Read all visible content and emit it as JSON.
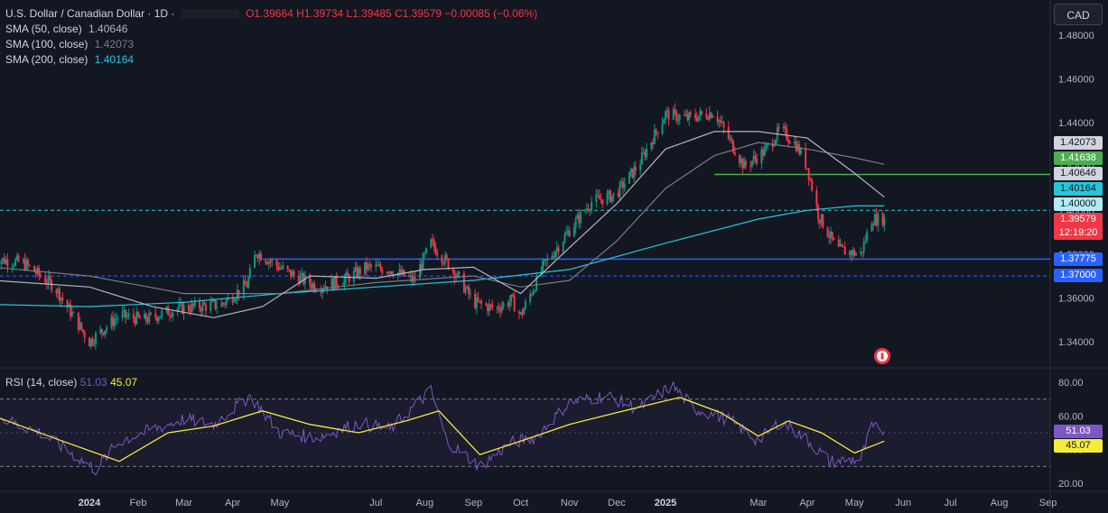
{
  "legend": {
    "title": "U.S. Dollar / Canadian Dollar · 1D ·",
    "open": "O1.39664",
    "high": "H1.39734",
    "low": "L1.39485",
    "close": "C1.39579",
    "change": "−0.00085 (−0.06%)",
    "sma50_label": "SMA (50, close)",
    "sma50_value": "1.40646",
    "sma100_label": "SMA (100, close)",
    "sma100_value": "1.42073",
    "sma200_label": "SMA (200, close)",
    "sma200_value": "1.40164",
    "rsi_label": "RSI (14, close)",
    "rsi_value": "51.03",
    "rsi_ma_value": "45.07"
  },
  "currency_button": "CAD",
  "price_tags": {
    "sma100": "1.42073",
    "level_green": "1.41638",
    "sma50": "1.40646",
    "sma200": "1.40164",
    "level_dashed_upper": "1.40000",
    "last_price": "1.39579",
    "countdown": "12:19:20",
    "level_blue": "1.37775",
    "level_dashed_lower": "1.37000",
    "rsi_value": "51.03",
    "rsi_ma": "45.07"
  },
  "colors": {
    "background": "#131722",
    "up_candle": "#089981",
    "down_candle": "#f23645",
    "sma50": "#b2b5be",
    "sma100": "#787b86",
    "sma200": "#26c6da",
    "green_line": "#4caf50",
    "blue_line": "#2962ff",
    "rsi_line": "#7e57c2",
    "rsi_ma": "#f5eb3b"
  },
  "chart_data": [
    {
      "type": "candlestick",
      "title": "U.S. Dollar / Canadian Dollar · 1D",
      "y_axis_ticks": [
        1.34,
        1.36,
        1.38,
        1.4,
        1.42,
        1.44,
        1.46,
        1.48
      ],
      "y_axis_tick_labels": [
        "1.34000",
        "1.36000",
        "1.38000",
        "1.40000",
        "1.42000",
        "1.44000",
        "1.46000",
        "1.48000"
      ],
      "x_axis_labels": [
        "2024",
        "Feb",
        "Mar",
        "Apr",
        "May",
        "Jul",
        "Aug",
        "Sep",
        "Oct",
        "Nov",
        "Dec",
        "2025",
        "Mar",
        "Apr",
        "May",
        "Jun",
        "Jul",
        "Aug",
        "Sep"
      ],
      "x_axis_dates": [
        "2024-01-01",
        "2024-02-01",
        "2024-03-01",
        "2024-04-01",
        "2024-05-01",
        "2024-07-01",
        "2024-08-01",
        "2024-09-01",
        "2024-10-01",
        "2024-11-01",
        "2024-12-01",
        "2025-01-01",
        "2025-03-01",
        "2025-04-01",
        "2025-05-01",
        "2025-06-01",
        "2025-07-01",
        "2025-08-01",
        "2025-09-01"
      ],
      "last_close": 1.39579,
      "horizontal_levels": [
        {
          "value": 1.41638,
          "style": "solid",
          "color": "#4caf50",
          "from_date": "2025-02-01"
        },
        {
          "value": 1.4,
          "style": "dashed",
          "color": "#26c6da"
        },
        {
          "value": 1.37775,
          "style": "solid",
          "color": "#2962ff",
          "from_date": "2024-04-20"
        },
        {
          "value": 1.37,
          "style": "dashed",
          "color": "#2962ff"
        }
      ],
      "series_price": {
        "name": "U.S. Dollar / Canadian Dollar",
        "dates": [
          "2023-11-01",
          "2023-11-20",
          "2023-12-10",
          "2024-01-01",
          "2024-01-20",
          "2024-02-05",
          "2024-02-25",
          "2024-03-10",
          "2024-03-25",
          "2024-04-10",
          "2024-04-16",
          "2024-05-05",
          "2024-05-25",
          "2024-06-10",
          "2024-06-25",
          "2024-07-10",
          "2024-07-25",
          "2024-08-05",
          "2024-08-20",
          "2024-09-01",
          "2024-09-15",
          "2024-09-25",
          "2024-10-01",
          "2024-10-15",
          "2024-10-31",
          "2024-11-15",
          "2024-11-30",
          "2024-12-15",
          "2025-01-01",
          "2025-01-15",
          "2025-02-01",
          "2025-02-10",
          "2025-02-20",
          "2025-03-05",
          "2025-03-15",
          "2025-03-25",
          "2025-04-01",
          "2025-04-08",
          "2025-04-20",
          "2025-05-05",
          "2025-05-12",
          "2025-05-20"
        ],
        "values": [
          1.378,
          1.376,
          1.365,
          1.34,
          1.352,
          1.35,
          1.355,
          1.356,
          1.357,
          1.366,
          1.381,
          1.372,
          1.365,
          1.368,
          1.374,
          1.373,
          1.368,
          1.385,
          1.372,
          1.358,
          1.355,
          1.359,
          1.352,
          1.374,
          1.39,
          1.404,
          1.407,
          1.421,
          1.444,
          1.442,
          1.445,
          1.433,
          1.42,
          1.427,
          1.437,
          1.43,
          1.42,
          1.398,
          1.382,
          1.38,
          1.396,
          1.396
        ]
      },
      "series_sma50": {
        "name": "SMA (50, close)",
        "dates": [
          "2023-11-01",
          "2024-01-01",
          "2024-02-10",
          "2024-03-20",
          "2024-04-20",
          "2024-05-20",
          "2024-07-01",
          "2024-08-01",
          "2024-09-01",
          "2024-10-01",
          "2024-11-01",
          "2024-12-01",
          "2025-01-01",
          "2025-02-01",
          "2025-03-01",
          "2025-04-01",
          "2025-05-01",
          "2025-05-20"
        ],
        "values": [
          1.368,
          1.365,
          1.356,
          1.351,
          1.356,
          1.37,
          1.369,
          1.373,
          1.374,
          1.362,
          1.383,
          1.403,
          1.428,
          1.436,
          1.436,
          1.433,
          1.417,
          1.406
        ]
      },
      "series_sma100": {
        "name": "SMA (100, close)",
        "dates": [
          "2023-11-01",
          "2024-01-01",
          "2024-03-01",
          "2024-05-01",
          "2024-07-01",
          "2024-09-01",
          "2024-10-01",
          "2024-11-01",
          "2024-12-01",
          "2025-01-01",
          "2025-02-01",
          "2025-03-01",
          "2025-04-01",
          "2025-05-01",
          "2025-05-20"
        ],
        "values": [
          1.374,
          1.37,
          1.362,
          1.362,
          1.367,
          1.37,
          1.365,
          1.368,
          1.386,
          1.41,
          1.425,
          1.431,
          1.428,
          1.424,
          1.421
        ]
      },
      "series_sma200": {
        "name": "SMA (200, close)",
        "dates": [
          "2023-11-01",
          "2024-01-01",
          "2024-03-01",
          "2024-05-01",
          "2024-07-01",
          "2024-09-01",
          "2024-11-01",
          "2025-01-01",
          "2025-03-01",
          "2025-04-01",
          "2025-05-01",
          "2025-05-20"
        ],
        "values": [
          1.357,
          1.356,
          1.358,
          1.362,
          1.365,
          1.368,
          1.373,
          1.385,
          1.396,
          1.4,
          1.402,
          1.402
        ]
      }
    },
    {
      "type": "line",
      "title": "RSI (14, close)",
      "y_axis_ticks": [
        20,
        40,
        60,
        80
      ],
      "y_axis_tick_labels": [
        "20.00",
        "40.00",
        "60.00",
        "80.00"
      ],
      "bands": [
        30,
        70
      ],
      "series": [
        {
          "name": "RSI",
          "dates": [
            "2023-11-01",
            "2023-12-01",
            "2024-01-05",
            "2024-01-20",
            "2024-02-10",
            "2024-03-01",
            "2024-03-20",
            "2024-04-12",
            "2024-05-01",
            "2024-05-25",
            "2024-06-20",
            "2024-07-10",
            "2024-08-05",
            "2024-08-15",
            "2024-09-05",
            "2024-09-25",
            "2024-10-10",
            "2024-11-01",
            "2024-11-25",
            "2024-12-15",
            "2025-01-05",
            "2025-01-20",
            "2025-02-10",
            "2025-03-01",
            "2025-03-15",
            "2025-04-01",
            "2025-04-15",
            "2025-05-05",
            "2025-05-12",
            "2025-05-20"
          ],
          "values": [
            60,
            50,
            28,
            45,
            52,
            58,
            55,
            72,
            50,
            47,
            56,
            52,
            75,
            45,
            30,
            44,
            47,
            68,
            72,
            64,
            78,
            64,
            58,
            45,
            57,
            46,
            33,
            34,
            53,
            51
          ]
        },
        {
          "name": "RSI-based MA",
          "dates": [
            "2023-11-01",
            "2023-12-15",
            "2024-01-20",
            "2024-02-20",
            "2024-03-20",
            "2024-04-20",
            "2024-05-20",
            "2024-06-20",
            "2024-07-20",
            "2024-08-10",
            "2024-09-05",
            "2024-10-01",
            "2024-11-01",
            "2024-12-01",
            "2025-01-10",
            "2025-02-05",
            "2025-03-01",
            "2025-03-20",
            "2025-04-10",
            "2025-05-01",
            "2025-05-20"
          ],
          "values": [
            60,
            45,
            33,
            50,
            54,
            63,
            55,
            50,
            57,
            63,
            37,
            45,
            55,
            62,
            71,
            62,
            48,
            57,
            50,
            38,
            45
          ]
        }
      ]
    }
  ]
}
